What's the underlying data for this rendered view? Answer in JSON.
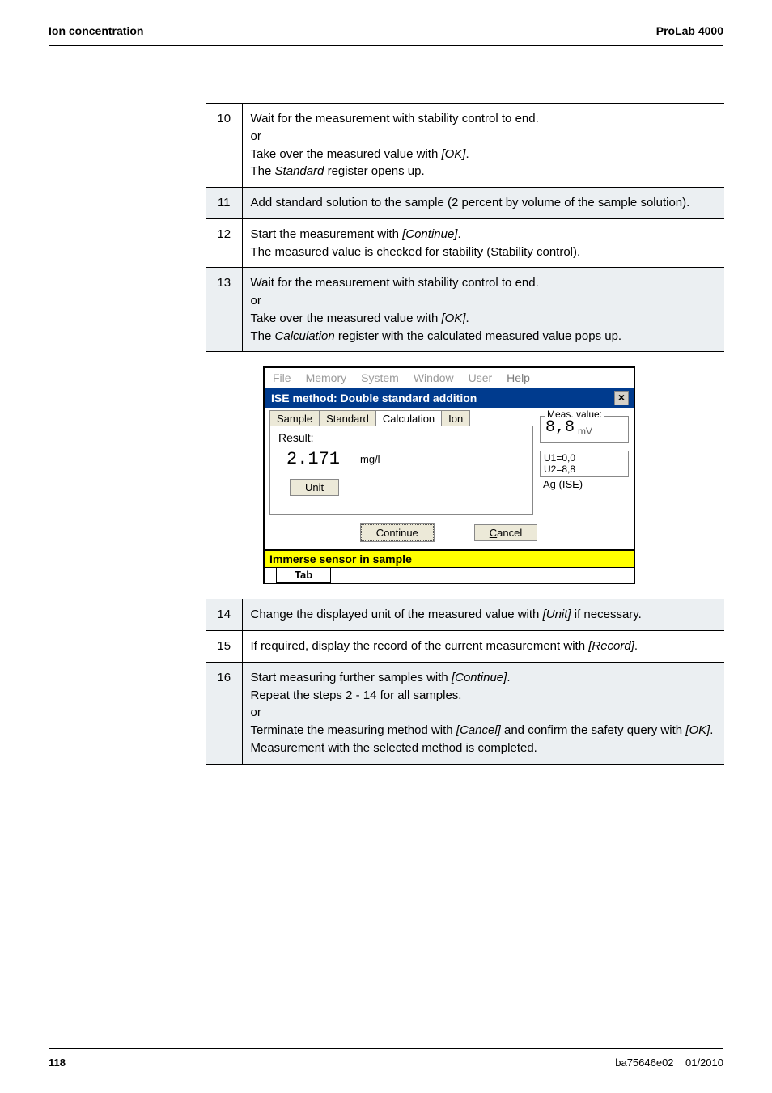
{
  "header": {
    "left": "Ion concentration",
    "right": "ProLab 4000"
  },
  "steps1": [
    {
      "n": "10",
      "shaded": false,
      "lines": [
        "Wait for the measurement with stability control to end.",
        "or",
        "Take over the measured value with [OK].",
        "The Standard register opens up."
      ],
      "italics": [
        [],
        [],
        [
          "[OK]"
        ],
        [
          "Standard"
        ]
      ]
    },
    {
      "n": "11",
      "shaded": true,
      "lines": [
        "Add standard solution to the sample (2 percent by volume of the sample solution)."
      ],
      "italics": [
        []
      ]
    },
    {
      "n": "12",
      "shaded": false,
      "lines": [
        "Start the measurement with [Continue].",
        "The measured value is checked for stability (Stability control)."
      ],
      "italics": [
        [
          "[Continue]"
        ],
        []
      ]
    },
    {
      "n": "13",
      "shaded": true,
      "lines": [
        "Wait for the measurement with stability control to end.",
        "or",
        "Take over the measured value with [OK].",
        "The Calculation register with the calculated measured value pops up."
      ],
      "italics": [
        [],
        [],
        [
          "[OK]"
        ],
        [
          "Calculation"
        ]
      ]
    }
  ],
  "dialog": {
    "menus": [
      "File",
      "Memory",
      "System",
      "Window",
      "User",
      "Help"
    ],
    "title": "ISE method:  Double standard addition",
    "close": "×",
    "tabs": [
      "Sample",
      "Standard",
      "Calculation",
      "Ion"
    ],
    "result_label": "Result:",
    "result_value": "2.171",
    "result_unit": "mg/l",
    "unit_btn": "Unit",
    "meas_label": "Meas. value:",
    "meas_value": "8,8",
    "meas_unit": "mV",
    "u1": "U1=0,0",
    "u2": "U2=8,8",
    "ag": "Ag (ISE)",
    "continue": "Continue",
    "cancel": "Cancel",
    "status": "Immerse sensor in sample",
    "bottom_tab": "Tab"
  },
  "steps2": [
    {
      "n": "14",
      "shaded": true,
      "lines": [
        "Change the displayed unit of the measured value with [Unit] if necessary."
      ],
      "italics": [
        [
          "[Unit]"
        ]
      ]
    },
    {
      "n": "15",
      "shaded": false,
      "lines": [
        "If required, display the record of the current measurement with [Record]."
      ],
      "italics": [
        [
          "[Record]"
        ]
      ]
    },
    {
      "n": "16",
      "shaded": true,
      "lines": [
        "Start measuring further samples with [Continue].",
        "Repeat the steps 2 - 14 for all samples.",
        "or",
        "Terminate the measuring method with [Cancel] and confirm the safety query with [OK].",
        "Measurement with the selected method is completed."
      ],
      "italics": [
        [
          "[Continue]"
        ],
        [],
        [],
        [
          "[Cancel]",
          "[OK]"
        ],
        []
      ]
    }
  ],
  "footer": {
    "page": "118",
    "code": "ba75646e02",
    "date": "01/2010"
  }
}
